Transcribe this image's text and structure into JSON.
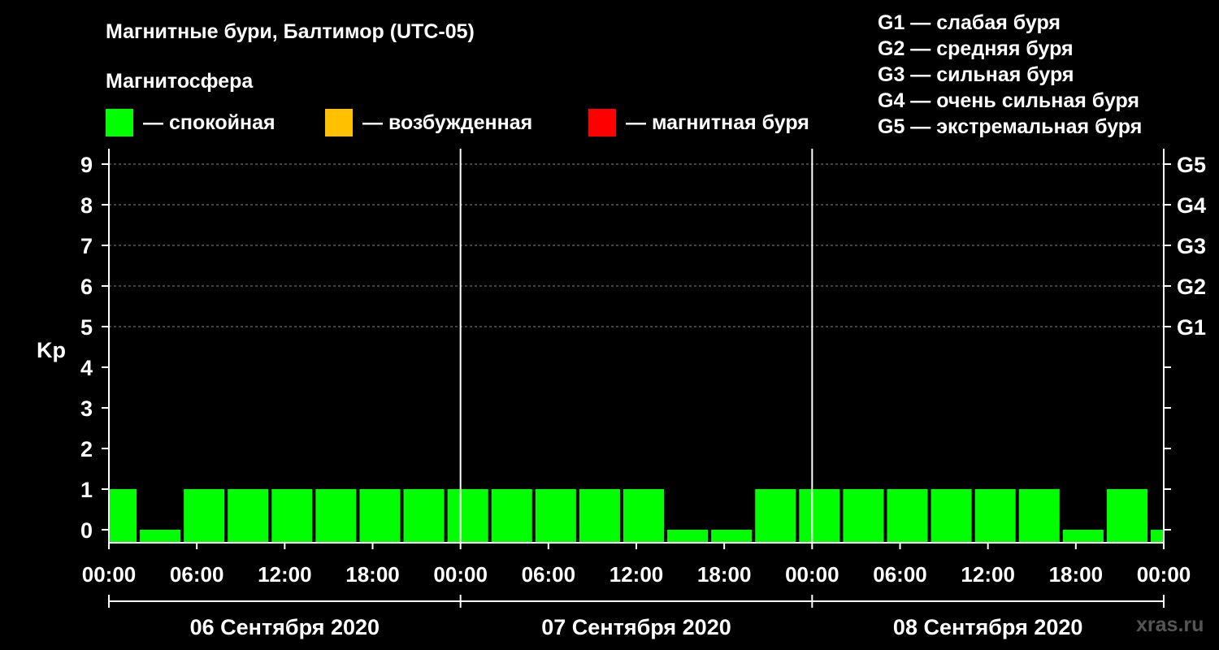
{
  "title": "Магнитные бури, Балтимор (UTC-05)",
  "magnetosphere": {
    "label": "Магнитосфера",
    "legend": [
      {
        "label": "— спокойная",
        "color": "#00ff00"
      },
      {
        "label": "— возбужденная",
        "color": "#ffc000"
      },
      {
        "label": "— магнитная буря",
        "color": "#ff0000"
      }
    ]
  },
  "g_scale": [
    "G1 — слабая буря",
    "G2 — средняя буря",
    "G3 — сильная буря",
    "G4 — очень сильная буря",
    "G5 — экстремальная буря"
  ],
  "watermark": "xras.ru",
  "chart_data": {
    "type": "bar",
    "ylabel": "Kp",
    "ylim": [
      0,
      9
    ],
    "yticks": [
      "0",
      "1",
      "2",
      "3",
      "4",
      "5",
      "6",
      "7",
      "8",
      "9"
    ],
    "right_ticks": [
      {
        "value": 5,
        "label": "G1"
      },
      {
        "value": 6,
        "label": "G2"
      },
      {
        "value": 7,
        "label": "G3"
      },
      {
        "value": 8,
        "label": "G4"
      },
      {
        "value": 9,
        "label": "G5"
      }
    ],
    "xticks": [
      "00:00",
      "06:00",
      "12:00",
      "18:00",
      "00:00",
      "06:00",
      "12:00",
      "18:00",
      "00:00",
      "06:00",
      "12:00",
      "18:00",
      "00:00"
    ],
    "days": [
      "06 Сентября 2020",
      "07 Сентября 2020",
      "08 Сентября 2020"
    ],
    "bar_start_hour": -1,
    "bar_hours": 3,
    "total_hours": 72,
    "values": [
      1,
      0,
      1,
      1,
      1,
      1,
      1,
      1,
      1,
      1,
      1,
      1,
      1,
      0,
      0,
      1,
      1,
      1,
      1,
      1,
      1,
      1,
      0,
      1,
      0
    ],
    "bar_color": "#00ff00",
    "grid": "dashed horizontal at 5-9",
    "legend_position": "top"
  }
}
